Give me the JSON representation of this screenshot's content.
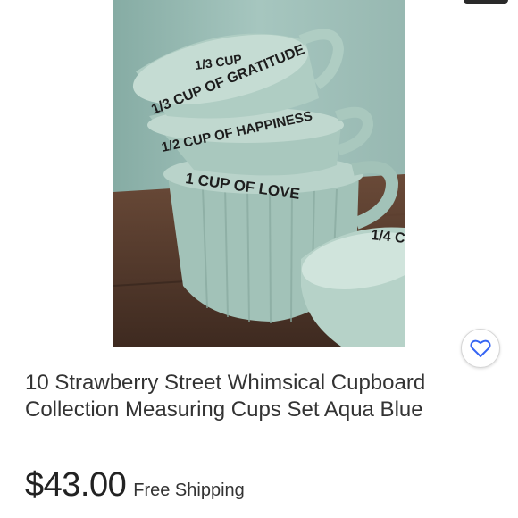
{
  "listing": {
    "title": "10 Strawberry Street Whimsical Cupboard Collection Measuring Cups Set Aqua Blue",
    "price": "$43.00",
    "shipping": "Free Shipping"
  },
  "photo": {
    "cup_texts": [
      "1/3 CUP",
      "1/3 CUP OF GRATITUDE",
      "1/2 CUP OF HAPPINESS",
      "1 CUP OF LOVE",
      "1/4 C"
    ],
    "colors": {
      "wall": "#9fc1ba",
      "cup_glaze": "#a4c4ba",
      "cup_shadow": "#84a69c",
      "wood": "#4e3426",
      "lettering": "#1d1d1d"
    }
  },
  "actions": {
    "favorite_icon": "heart-outline-icon",
    "accent": "#3665f3"
  }
}
